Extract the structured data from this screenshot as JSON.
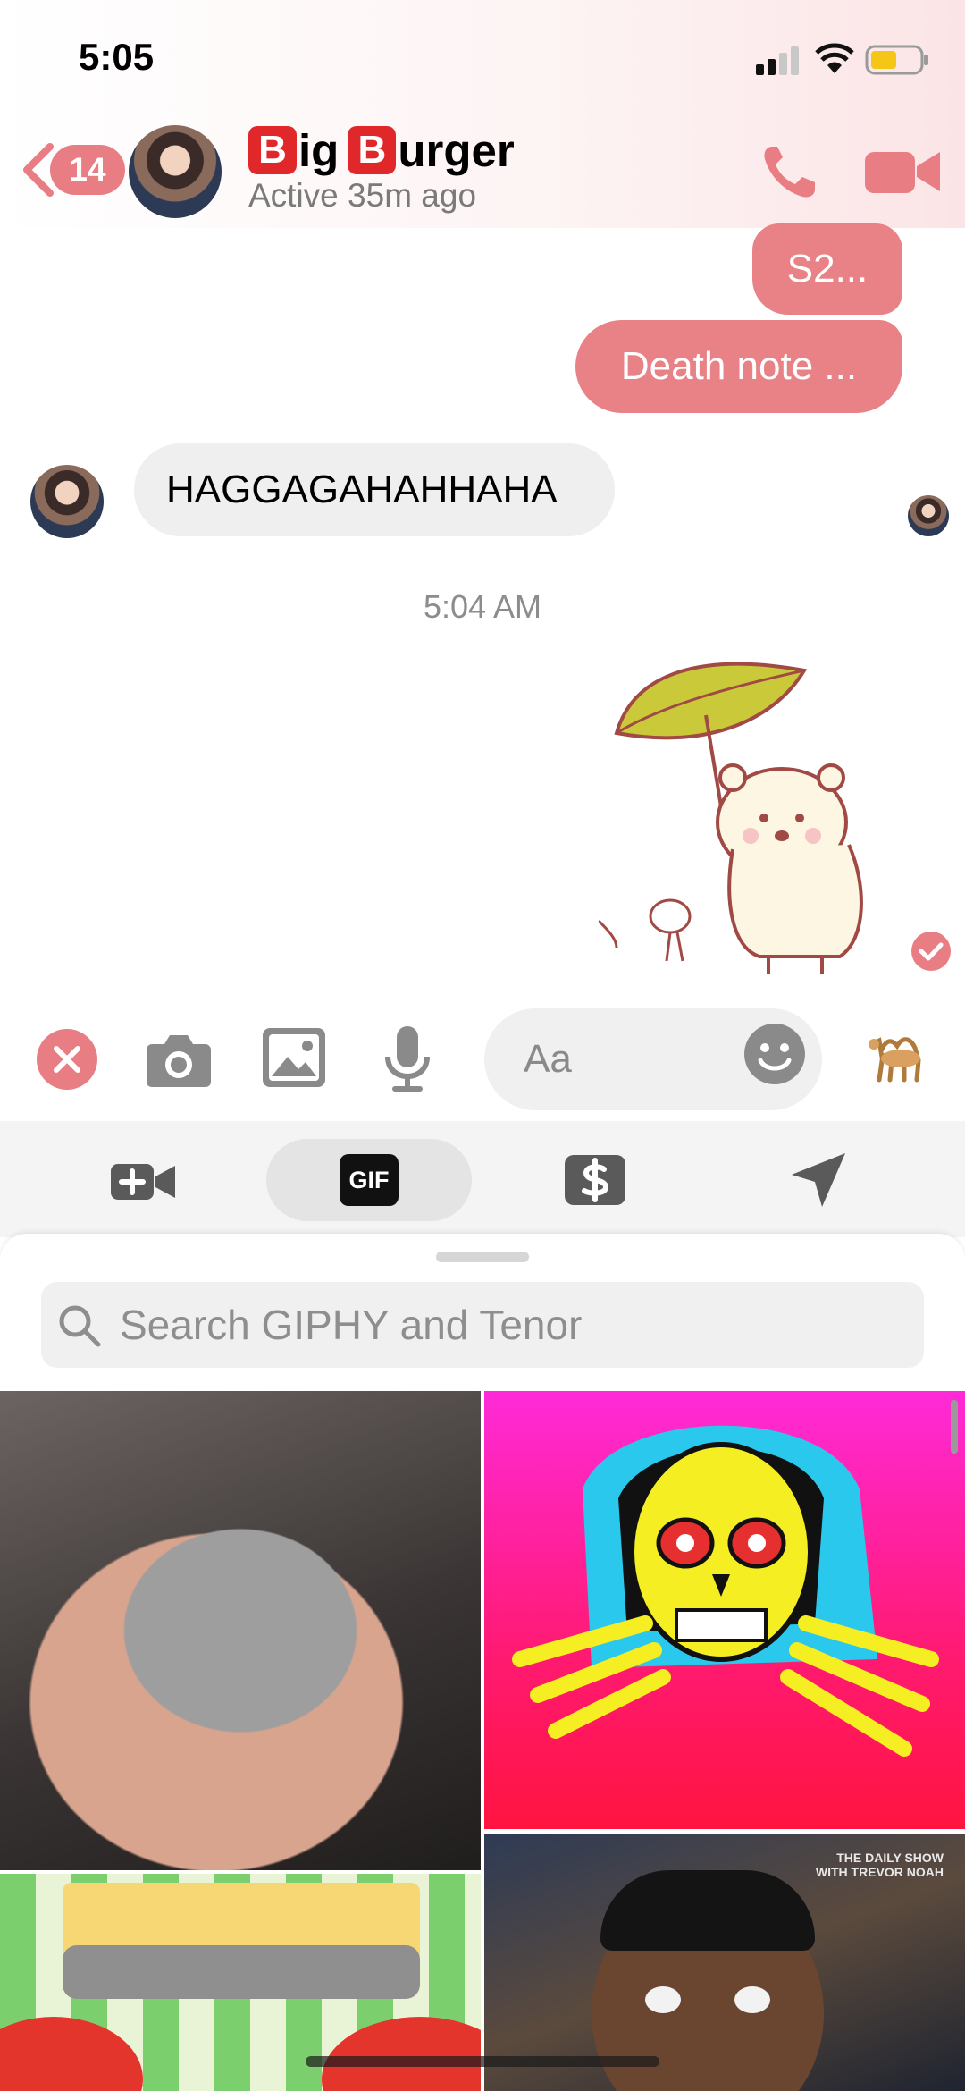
{
  "status_bar": {
    "time": "5:05"
  },
  "header": {
    "unread_count": "14",
    "title_prefix_letter": "B",
    "title_part1": "ig",
    "title_part2_letter": "B",
    "title_part3": "urger",
    "subtitle": "Active 35m ago"
  },
  "messages": {
    "outgoing": [
      "S2...",
      "Death note ..."
    ],
    "incoming": "HAGGAGAHAHHAHA",
    "timestamp": "5:04 AM"
  },
  "composer": {
    "placeholder": "Aa"
  },
  "gif_tab_label": "GIF",
  "gif_search": {
    "placeholder": "Search GIPHY and Tenor"
  },
  "gif_tiles": {
    "show_logo_line1": "THE DAILY SHOW",
    "show_logo_line2": "WITH TREVOR NOAH"
  },
  "colors": {
    "accent": "#e98287",
    "badge": "#e97d84"
  }
}
